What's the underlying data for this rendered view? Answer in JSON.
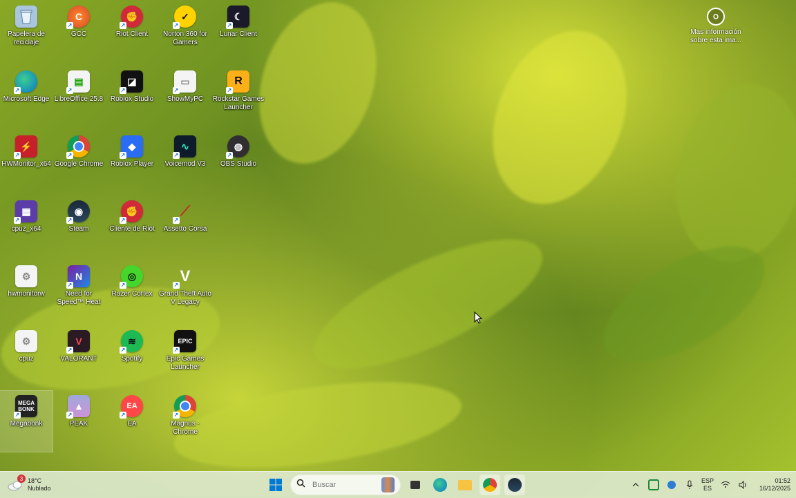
{
  "desktop": {
    "icons": [
      {
        "label": "Papelera de reciclaje",
        "icon": "recycle-bin-icon"
      },
      {
        "label": "GCC",
        "icon": "gcc-icon"
      },
      {
        "label": "Riot Client",
        "icon": "riot-client-icon"
      },
      {
        "label": "Norton 360 for Gamers",
        "icon": "norton-icon"
      },
      {
        "label": "Lunar Client",
        "icon": "lunar-client-icon"
      },
      {
        "label": "Microsoft Edge",
        "icon": "edge-icon"
      },
      {
        "label": "LibreOffice 25.8",
        "icon": "libreoffice-icon"
      },
      {
        "label": "Roblox Studio",
        "icon": "roblox-studio-icon"
      },
      {
        "label": "ShowMyPC",
        "icon": "showmypc-icon"
      },
      {
        "label": "Rockstar Games Launcher",
        "icon": "rockstar-icon"
      },
      {
        "label": "HWMonitor_x64",
        "icon": "hwmonitor-icon"
      },
      {
        "label": "Google Chrome",
        "icon": "chrome-icon"
      },
      {
        "label": "Roblox Player",
        "icon": "roblox-player-icon"
      },
      {
        "label": "Voicemod V3",
        "icon": "voicemod-icon"
      },
      {
        "label": "OBS Studio",
        "icon": "obs-icon"
      },
      {
        "label": "cpuz_x64",
        "icon": "cpuz-icon"
      },
      {
        "label": "Steam",
        "icon": "steam-icon"
      },
      {
        "label": "Cliente de Riot",
        "icon": "riot-client-icon"
      },
      {
        "label": "Assetto Corsa",
        "icon": "assetto-corsa-icon"
      },
      {
        "label": "hwmonitorw",
        "icon": "file-icon"
      },
      {
        "label": "Need for Speed™ Heat",
        "icon": "nfs-heat-icon"
      },
      {
        "label": "Razer Cortex",
        "icon": "razer-cortex-icon"
      },
      {
        "label": "Grand Theft Auto V Legacy",
        "icon": "gta-v-icon"
      },
      {
        "label": "cpuz",
        "icon": "file-icon"
      },
      {
        "label": "VALORANT",
        "icon": "valorant-icon"
      },
      {
        "label": "Spotify",
        "icon": "spotify-icon"
      },
      {
        "label": "Epic Games Launcher",
        "icon": "epic-games-icon"
      },
      {
        "label": "Megabonk",
        "icon": "megabonk-icon"
      },
      {
        "label": "PEAK",
        "icon": "peak-icon"
      },
      {
        "label": "EA",
        "icon": "ea-icon"
      },
      {
        "label": "Magnus - Chrome",
        "icon": "chrome-profile-icon"
      }
    ],
    "info_link": "Mas información sobre esta ima..."
  },
  "taskbar": {
    "weather": {
      "temp": "18°C",
      "condition": "Nublado",
      "badge": "3"
    },
    "search_placeholder": "Buscar",
    "lang_top": "ESP",
    "lang_bottom": "ES",
    "time": "01:52",
    "date": "16/12/2025"
  },
  "colors": {
    "taskbar": "#dce8cc",
    "accent": "#0078d4",
    "badge": "#d13438"
  }
}
